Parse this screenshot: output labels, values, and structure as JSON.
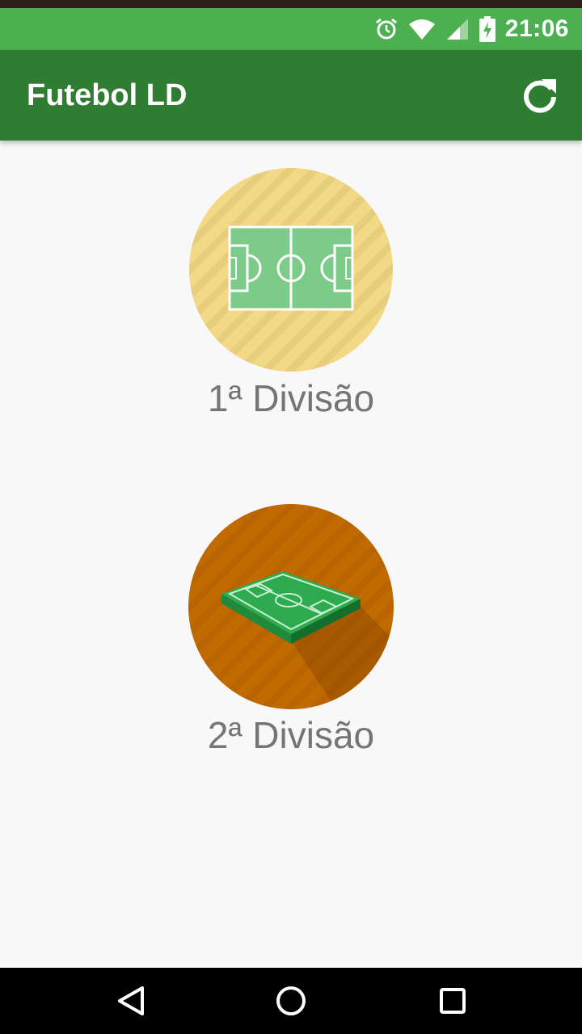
{
  "status": {
    "time": "21:06"
  },
  "app": {
    "title": "Futebol LD"
  },
  "divisions": [
    {
      "label": "1ª Divisão",
      "icon": "soccer-field-top-icon"
    },
    {
      "label": "2ª Divisão",
      "icon": "soccer-field-3d-icon"
    }
  ],
  "colors": {
    "status_bar": "#4caf50",
    "app_bar": "#2e7d32",
    "division1_bg": "#f3d985",
    "division2_bg": "#c06a00",
    "label": "#757575"
  }
}
